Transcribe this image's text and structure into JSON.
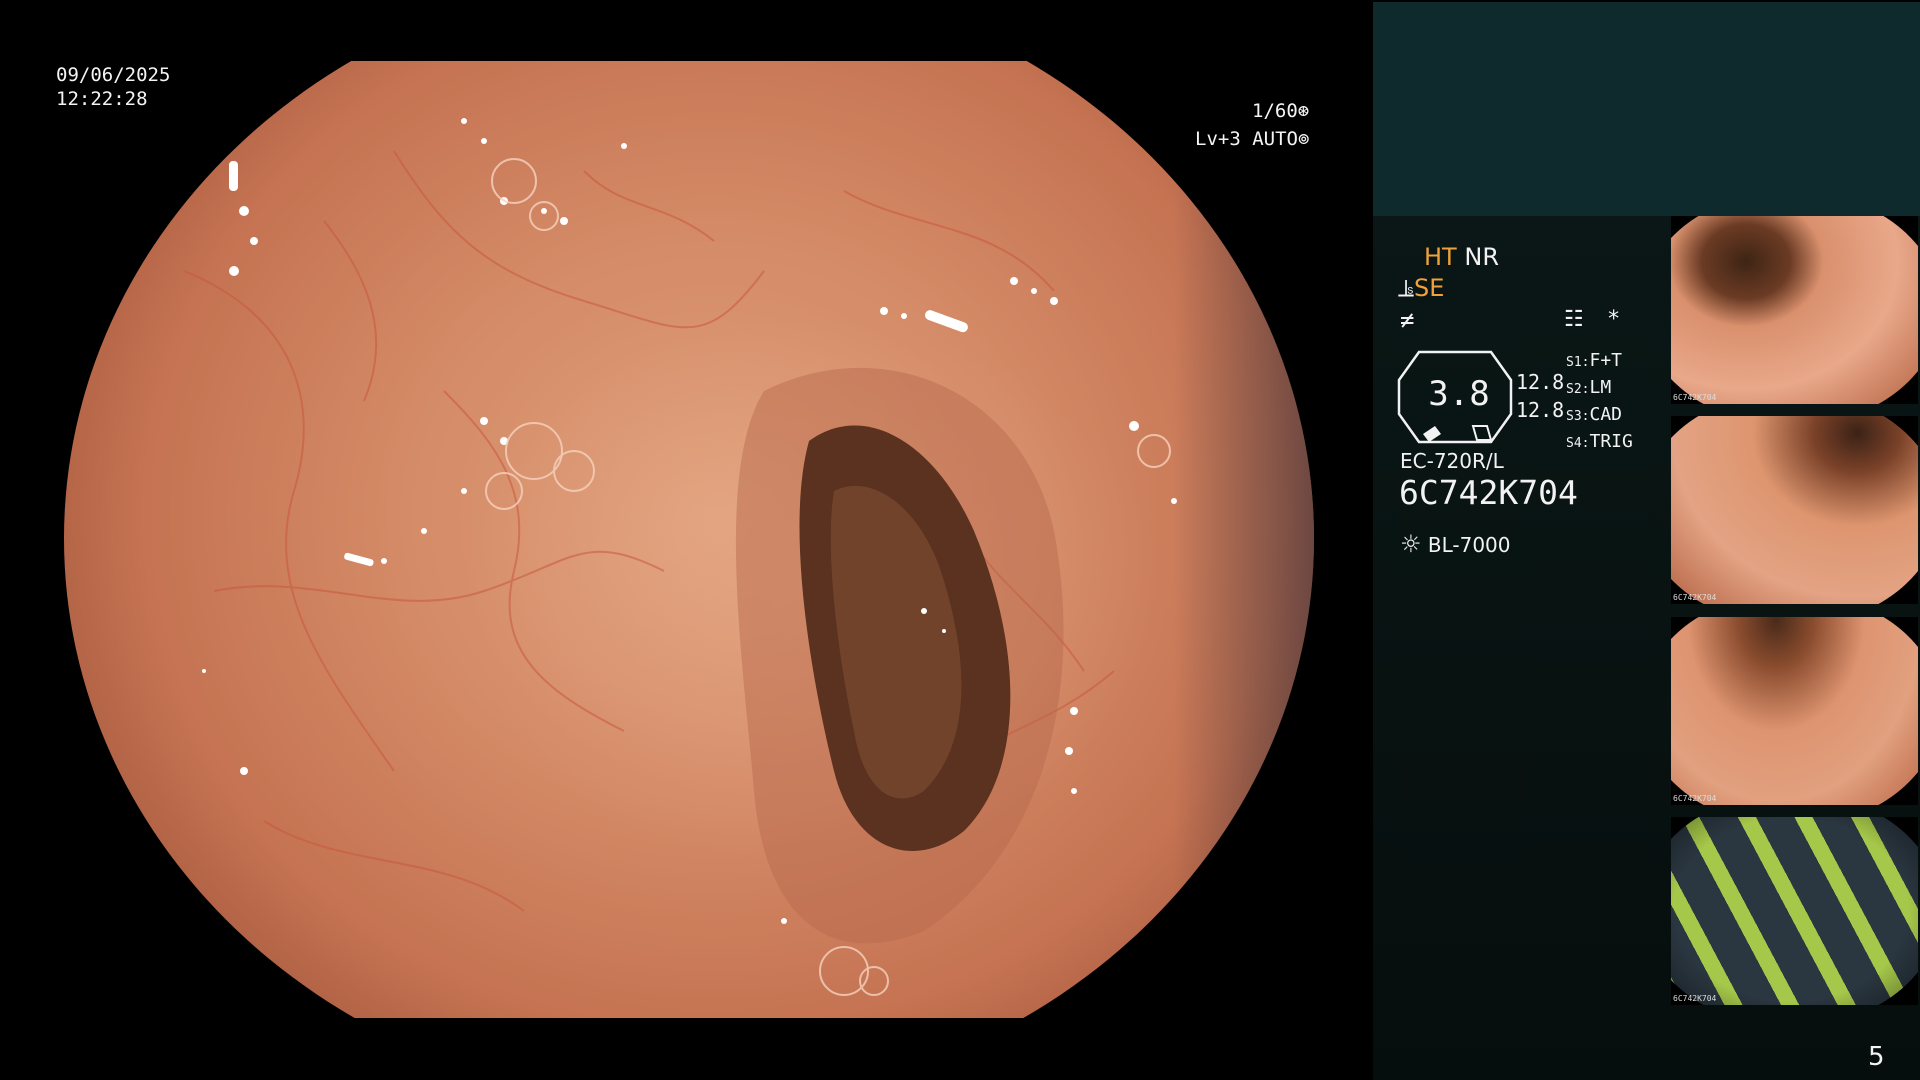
{
  "overlay": {
    "date": "09/06/2025",
    "time": "12:22:28",
    "shutter": "1/60",
    "shutter_icon": "aperture-icon",
    "level": "Lv+3",
    "mode": "AUTO",
    "mode_icon": "auto-iris-icon"
  },
  "panel": {
    "ht_label": "HT",
    "nr_label": "NR",
    "se_label": "SE",
    "structure_icon": "structure-enhance-icon",
    "color_icon": "color-enhance-icon",
    "menu_icon": "settings-menu-icon",
    "star": "*",
    "zoom": "3.8",
    "ratio_a": "12.8",
    "ratio_b": "12.8",
    "switches": [
      {
        "key": "S1:",
        "value": "F+T"
      },
      {
        "key": "S2:",
        "value": "LM"
      },
      {
        "key": "S3:",
        "value": "CAD"
      },
      {
        "key": "S4:",
        "value": "TRIG"
      }
    ],
    "scope_model": "EC-720R/L",
    "scope_serial": "6C742K704",
    "light_source": "BL-7000",
    "light_icon": "light-source-icon"
  },
  "thumbnails": [
    {
      "label": "6C742K704"
    },
    {
      "label": "6C742K704"
    },
    {
      "label": "6C742K704"
    },
    {
      "label": "6C742K704"
    }
  ],
  "page_number": "5",
  "colors": {
    "accent_orange": "#f0a23a",
    "panel_top": "#0e2a2c",
    "panel_bg": "#0a1716",
    "mucosa": "#d48a66"
  }
}
